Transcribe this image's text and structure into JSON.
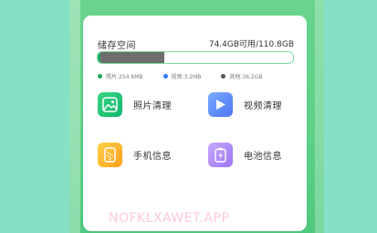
{
  "storage": {
    "title": "储存空间",
    "value": "74.4GB可用/110.8GB",
    "segments": [
      {
        "name": "photos",
        "fraction": 0.012,
        "color": "#1ea85a"
      },
      {
        "name": "videos",
        "fraction": 0.0003,
        "color": "#3477ff"
      },
      {
        "name": "other",
        "fraction": 0.33,
        "color": "#6d6d6d"
      }
    ],
    "legend": [
      {
        "text": "照片:254.6MB",
        "color": "#1ea85a"
      },
      {
        "text": "视频:3.2MB",
        "color": "#3477ff"
      },
      {
        "text": "其他:36.2GB",
        "color": "#555555"
      }
    ]
  },
  "tools": [
    {
      "label": "照片清理",
      "icon": "photo-icon",
      "gradient": [
        "#37d482",
        "#12b86e"
      ]
    },
    {
      "label": "视频清理",
      "icon": "play-icon",
      "gradient": [
        "#7aa8ff",
        "#4d78f5"
      ]
    },
    {
      "label": "手机信息",
      "icon": "phone-icon",
      "gradient": [
        "#ffd14a",
        "#ff9f1a"
      ]
    },
    {
      "label": "电池信息",
      "icon": "battery-icon",
      "gradient": [
        "#c7a8ff",
        "#9b74f2"
      ]
    }
  ],
  "watermark": "NOFKLXAWET.APP"
}
